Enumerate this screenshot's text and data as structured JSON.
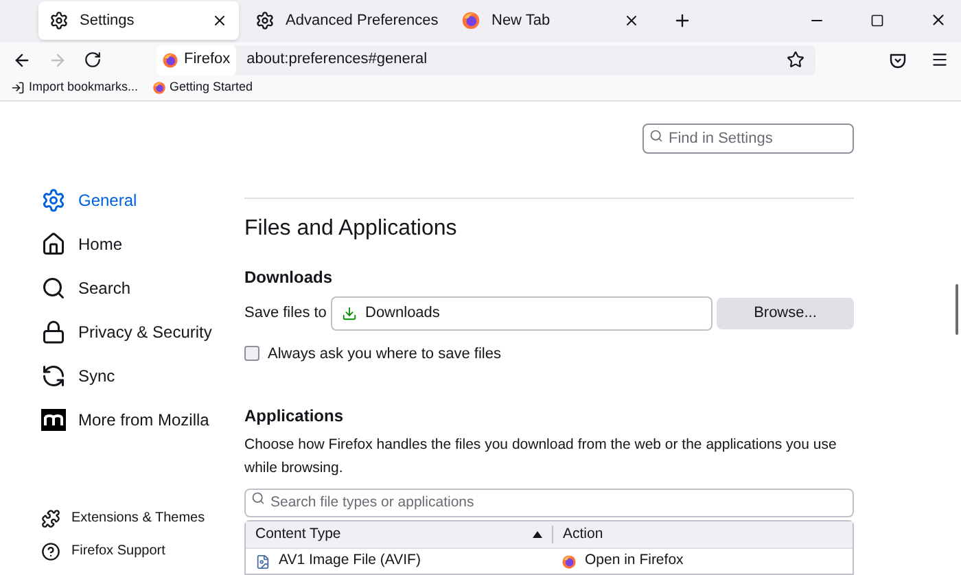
{
  "tabs": [
    {
      "label": "Settings",
      "kind": "settings",
      "selected": true
    },
    {
      "label": "Advanced Preferences",
      "kind": "settings",
      "selected": false
    },
    {
      "label": "New Tab",
      "kind": "firefox",
      "selected": false
    }
  ],
  "toolbar": {
    "forward_disabled": true,
    "identity": "Firefox",
    "address": "about:preferences#general"
  },
  "bookmarks": [
    {
      "label": "Import bookmarks...",
      "kind": "import"
    },
    {
      "label": "Getting Started",
      "kind": "firefox"
    }
  ],
  "find": {
    "placeholder": "Find in Settings"
  },
  "sidebar": {
    "items": [
      {
        "label": "General",
        "kind": "settings",
        "selected": true
      },
      {
        "label": "Home",
        "kind": "home",
        "selected": false
      },
      {
        "label": "Search",
        "kind": "search",
        "selected": false
      },
      {
        "label": "Privacy & Security",
        "kind": "lock",
        "selected": false
      },
      {
        "label": "Sync",
        "kind": "sync",
        "selected": false
      },
      {
        "label": "More from Mozilla",
        "kind": "mozilla",
        "selected": false
      }
    ],
    "footer": [
      {
        "label": "Extensions & Themes",
        "kind": "puzzle"
      },
      {
        "label": "Firefox Support",
        "kind": "help"
      }
    ]
  },
  "section_title": "Files and Applications",
  "downloads": {
    "heading": "Downloads",
    "save_label": "Save files to",
    "folder": "Downloads",
    "browse": "Browse...",
    "always_ask": {
      "label": "Always ask you where to save files",
      "checked": false
    }
  },
  "applications": {
    "heading": "Applications",
    "description": "Choose how Firefox handles the files you download from the web or the applications you use while browsing.",
    "search_placeholder": "Search file types or applications",
    "columns": [
      {
        "label": "Content Type",
        "sorted": true
      },
      {
        "label": "Action",
        "sorted": false
      }
    ],
    "rows": [
      {
        "content_type": "AV1 Image File (AVIF)",
        "action": "Open in Firefox"
      }
    ]
  }
}
